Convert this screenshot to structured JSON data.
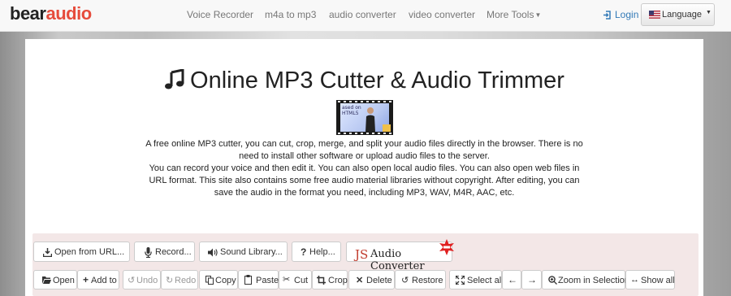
{
  "brand": {
    "part1": "bear",
    "part2": "audio"
  },
  "nav": {
    "items": [
      "Voice Recorder",
      "m4a to mp3",
      "audio converter",
      "video converter",
      "More Tools"
    ],
    "login": "Login",
    "language": "Language"
  },
  "page": {
    "title": "Online MP3 Cutter & Audio Trimmer",
    "thumbnail_text": [
      "ased on",
      "HTML5"
    ],
    "description": [
      "A free online MP3 cutter, you can cut, crop, merge, and split your audio files directly in the browser. There is no need to install other software or upload audio files to the server.",
      "You can record your voice and then edit it. You can also open local audio files. You can also open web files in URL format. This site also contains some free audio material libraries without copyright. After editing, you can save the audio in the format you need, including MP3, WAV, M4R, AAC, etc."
    ]
  },
  "toolbar_top": {
    "open_url": "Open from URL...",
    "record": "Record...",
    "sound_library": "Sound Library...",
    "help": "Help...",
    "js_badge": {
      "js": "JS",
      "name": "Audio Converter"
    }
  },
  "toolbar_bottom": {
    "open": "Open",
    "add_to": "Add to",
    "undo": "Undo",
    "redo": "Redo",
    "copy": "Copy",
    "paste": "Paste",
    "cut": "Cut",
    "crop": "Crop",
    "delete": "Delete",
    "restore": "Restore",
    "select_all": "Select all",
    "zoom_selection": "Zoom in Selection",
    "show_all": "Show all"
  },
  "colors": {
    "accent_red": "#e64c3c",
    "link_blue": "#337ab7",
    "editor_bg": "#f3e7e7"
  },
  "icons": [
    "music-note-icon",
    "login-icon",
    "us-flag-icon",
    "download-icon",
    "microphone-icon",
    "volume-icon",
    "question-icon",
    "folder-open-icon",
    "plus-icon",
    "undo-icon",
    "redo-icon",
    "copy-icon",
    "paste-icon",
    "scissors-icon",
    "crop-icon",
    "close-icon",
    "restore-icon",
    "fullscreen-icon",
    "arrow-left-icon",
    "arrow-right-icon",
    "zoom-in-icon",
    "resize-horizontal-icon"
  ]
}
